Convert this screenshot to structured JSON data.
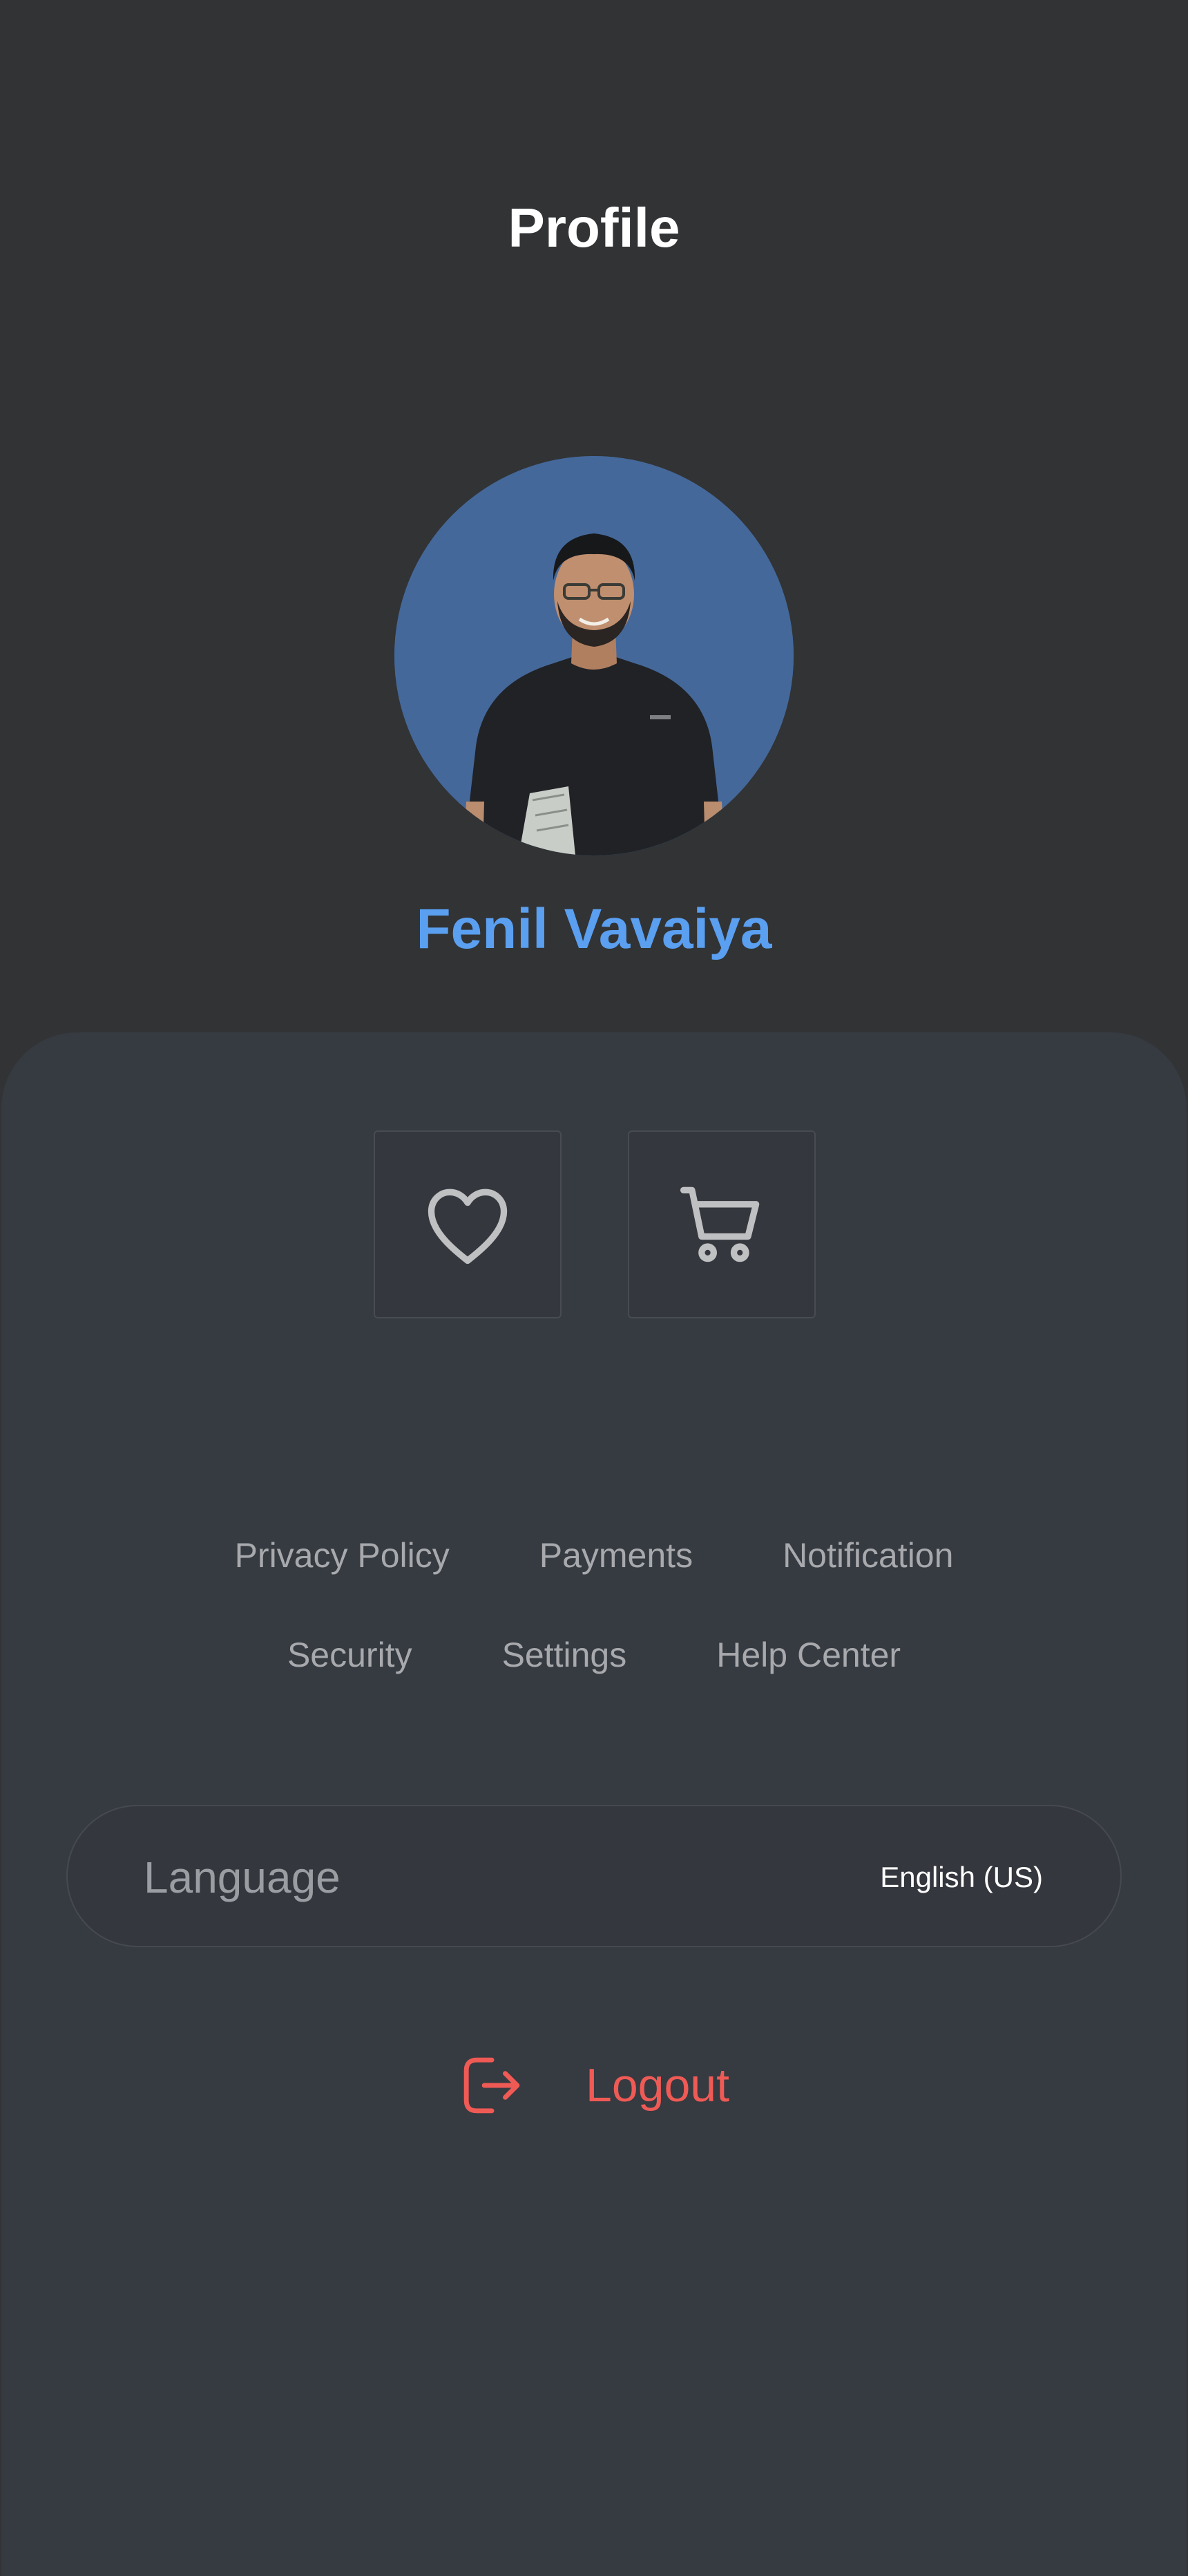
{
  "header": {
    "title": "Profile"
  },
  "profile": {
    "name": "Fenil Vavaiya",
    "avatar_icon": "user-photo",
    "name_color": "#5a9ff0"
  },
  "quick_actions": [
    {
      "icon": "heart-icon",
      "label": ""
    },
    {
      "icon": "cart-icon",
      "label": ""
    }
  ],
  "menu": {
    "row1": [
      "Privacy Policy",
      "Payments",
      "Notification"
    ],
    "row2": [
      "Security",
      "Settings",
      "Help Center"
    ]
  },
  "language": {
    "label": "Language",
    "value": "English (US)"
  },
  "logout": {
    "label": "Logout",
    "icon": "logout-icon",
    "color": "#f05a55"
  },
  "colors": {
    "background": "#313335",
    "panel": "#363a41",
    "avatar_bg": "#45689a"
  }
}
